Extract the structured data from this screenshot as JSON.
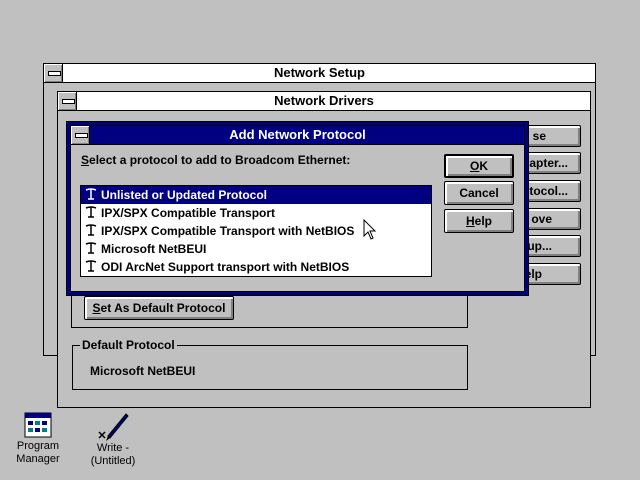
{
  "network_setup": {
    "title": "Network Setup"
  },
  "network_drivers": {
    "title": "Network Drivers",
    "side_buttons": [
      "se",
      "apter...",
      "tocol...",
      "ove",
      "up...",
      "elp"
    ],
    "set_default_label": "Set As Default Protocol",
    "default_protocol_group_label": "Default Protocol",
    "default_protocol_value": "Microsoft NetBEUI"
  },
  "add_protocol": {
    "title": "Add Network Protocol",
    "prompt": "Select a protocol to add to Broadcom Ethernet:",
    "protocols": [
      "Unlisted or Updated Protocol",
      "IPX/SPX Compatible Transport",
      "IPX/SPX Compatible Transport with NetBIOS",
      "Microsoft NetBEUI",
      "ODI ArcNet Support transport with NetBIOS"
    ],
    "selected_index": 0,
    "ok_label": "OK",
    "cancel_label": "Cancel",
    "help_label": "Help"
  },
  "desktop": {
    "icons": [
      {
        "label_line1": "Program",
        "label_line2": "Manager"
      },
      {
        "label_line1": "Write -",
        "label_line2": "(Untitled)"
      }
    ]
  }
}
